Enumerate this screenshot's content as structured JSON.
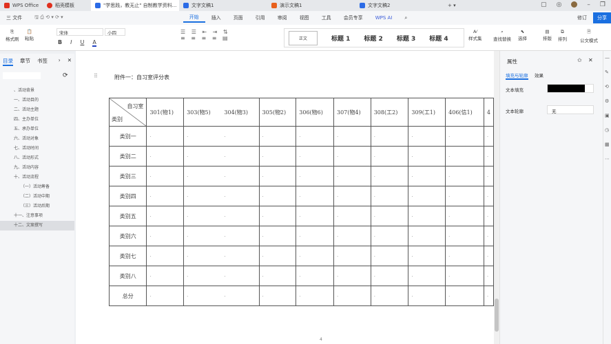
{
  "tabs": [
    {
      "label": "WPS Office",
      "color": "#e0301e"
    },
    {
      "label": "稻壳模板",
      "color": "#e0301e"
    },
    {
      "label": "\"学思践，教无止\" 自制教学资料...",
      "color": "#2b6be6",
      "active": true
    },
    {
      "label": "文字文稿1",
      "color": "#2b6be6"
    },
    {
      "label": "演示文稿1",
      "color": "#e8601c"
    },
    {
      "label": "文字文稿2",
      "color": "#2b6be6"
    }
  ],
  "menu": {
    "file": "三 文件",
    "items": [
      "开始",
      "插入",
      "页面",
      "引用",
      "审阅",
      "视图",
      "工具",
      "会员专享",
      "WPS AI"
    ],
    "selected": "开始",
    "share": "分享",
    "revise": "修订"
  },
  "ribbon": {
    "paste_a": "格式刷",
    "paste_b": "粘贴",
    "font": "宋体",
    "size": "小四",
    "bold": "B",
    "italic": "I",
    "underline": "U",
    "style_normal": "正文",
    "styles": [
      "标题 1",
      "标题 2",
      "标题 3",
      "标题 4"
    ],
    "tools": [
      "样式集",
      "查找替换",
      "选择",
      "排版",
      "排列",
      "公文模式"
    ]
  },
  "left": {
    "tabs": [
      "目录",
      "章节",
      "书签"
    ],
    "toc": [
      "、活动背景",
      "一、活动目的",
      "二、活动主题",
      "四、主办单位",
      "五、承办单位",
      "六、活动对象",
      "七、活动时间",
      "八、活动形式",
      "九、活动内容",
      "十、活动流程",
      "（一）活动筹备",
      "（二）活动中期",
      "（三）活动后期",
      "十一、注意事项",
      "十二、文案撰写"
    ]
  },
  "document": {
    "heading": "附件一：自习室评分表",
    "corner_top": "自习室",
    "corner_bottom": "类别",
    "columns": [
      "301(物1)",
      "303(物5)",
      "304(物3)",
      "305(物2)",
      "306(物6)",
      "307(物4)",
      "308(工2)",
      "309(工1)",
      "406(信1)",
      "4"
    ],
    "rows": [
      "类别一",
      "类别二",
      "类别三",
      "类别四",
      "类别五",
      "类别六",
      "类别七",
      "类别八",
      "总分"
    ],
    "page_number": "4"
  },
  "right": {
    "title": "属性",
    "tabs": [
      "填充与轮廓",
      "效果"
    ],
    "fill_label": "文本填充",
    "outline_label": "文本轮廓",
    "outline_value": "无",
    "fill_color": "#000000"
  }
}
